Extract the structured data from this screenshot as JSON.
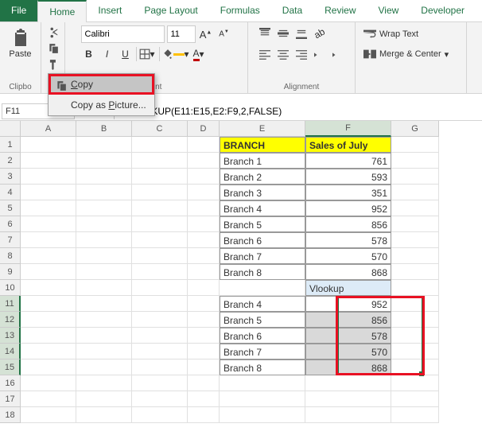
{
  "tabs": {
    "file": "File",
    "home": "Home",
    "insert": "Insert",
    "pageLayout": "Page Layout",
    "formulas": "Formulas",
    "data": "Data",
    "review": "Review",
    "view": "View",
    "developer": "Developer"
  },
  "ribbon": {
    "clipboard": {
      "paste": "Paste",
      "label": "Clipbo"
    },
    "font": {
      "name": "Calibri",
      "size": "11",
      "label": "ont"
    },
    "alignment": {
      "wrap": "Wrap Text",
      "merge": "Merge & Center",
      "label": "Alignment"
    }
  },
  "context": {
    "copy": "Copy",
    "copyPicture": "Copy as Picture..."
  },
  "nameBox": "F11",
  "formula": "=VLOOKUP(E11:E15,E2:F9,2,FALSE)",
  "headers": {
    "A": "A",
    "B": "B",
    "C": "C",
    "D": "D",
    "E": "E",
    "F": "F",
    "G": "G"
  },
  "rowNums": [
    "1",
    "2",
    "3",
    "4",
    "5",
    "6",
    "7",
    "8",
    "9",
    "10",
    "11",
    "12",
    "13",
    "14",
    "15",
    "16",
    "17",
    "18"
  ],
  "data": {
    "E1": "BRANCH",
    "F1": "Sales of July",
    "E2": "Branch 1",
    "F2": "761",
    "E3": "Branch 2",
    "F3": "593",
    "E4": "Branch 3",
    "F4": "351",
    "E5": "Branch 4",
    "F5": "952",
    "E6": "Branch 5",
    "F6": "856",
    "E7": "Branch 6",
    "F7": "578",
    "E8": "Branch 7",
    "F8": "570",
    "E9": "Branch 8",
    "F9": "868",
    "F10": "Vlookup",
    "E11": "Branch 4",
    "F11": "952",
    "E12": "Branch 5",
    "F12": "856",
    "E13": "Branch 6",
    "F13": "578",
    "E14": "Branch 7",
    "F14": "570",
    "E15": "Branch 8",
    "F15": "868"
  }
}
